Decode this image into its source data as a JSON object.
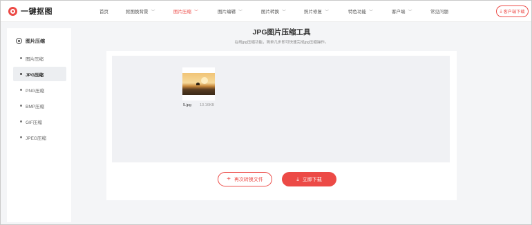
{
  "colors": {
    "accent": "#ec4a46",
    "page_bg": "#f4f5f7",
    "drop_bg": "#f0f1f4"
  },
  "header": {
    "logo_text": "一键抠图",
    "nav": [
      {
        "label": "首页",
        "dropdown": false,
        "active": false
      },
      {
        "label": "抠图换背景",
        "dropdown": true,
        "active": false
      },
      {
        "label": "图片压缩",
        "dropdown": true,
        "active": true
      },
      {
        "label": "图片编辑",
        "dropdown": true,
        "active": false
      },
      {
        "label": "图片转换",
        "dropdown": true,
        "active": false
      },
      {
        "label": "照片修复",
        "dropdown": true,
        "active": false
      },
      {
        "label": "特色功能",
        "dropdown": true,
        "active": false
      },
      {
        "label": "客户端",
        "dropdown": true,
        "active": false
      },
      {
        "label": "常见问题",
        "dropdown": false,
        "active": false
      }
    ],
    "client_button": "客户端下载"
  },
  "sidebar": {
    "title": "图片压缩",
    "items": [
      {
        "label": "图片压缩",
        "active": false
      },
      {
        "label": "JPG压缩",
        "active": true
      },
      {
        "label": "PNG压缩",
        "active": false
      },
      {
        "label": "BMP压缩",
        "active": false
      },
      {
        "label": "GIF压缩",
        "active": false
      },
      {
        "label": "JPEG压缩",
        "active": false
      }
    ]
  },
  "main": {
    "title": "JPG图片压缩工具",
    "subtitle": "在线jpg压缩功能，简单几步即可快速完成jpg压缩操作。",
    "file": {
      "name": "5.jpg",
      "size": "13.16KB"
    },
    "again_button": "再次转换文件",
    "download_button": "立即下载"
  }
}
